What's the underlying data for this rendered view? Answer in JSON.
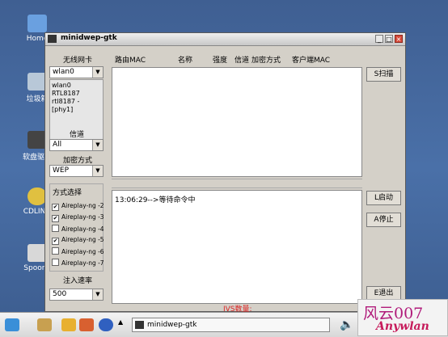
{
  "desktop": {
    "icons": [
      "Home",
      "垃圾箱",
      "软盘驱动",
      "CDLING",
      "Spoonv"
    ]
  },
  "window": {
    "title": "minidwep-gtk",
    "buttons": {
      "minimize": "_",
      "maximize": "□",
      "close": "×"
    }
  },
  "left": {
    "wireless_card_label": "无线网卡",
    "wireless_card_value": "wlan0",
    "interface_info": [
      "wlan0 RTL8187",
      "rtl8187 - [phy1]"
    ],
    "channel_label": "信道",
    "channel_value": "All",
    "encryption_label": "加密方式",
    "encryption_value": "WEP",
    "methods_label": "方式选择",
    "methods": [
      {
        "label": "Aireplay-ng -2",
        "checked": true
      },
      {
        "label": "Aireplay-ng -3",
        "checked": true
      },
      {
        "label": "Aireplay-ng -4",
        "checked": false
      },
      {
        "label": "Aireplay-ng -5",
        "checked": true
      },
      {
        "label": "Aireplay-ng -6",
        "checked": false
      },
      {
        "label": "Aireplay-ng -7",
        "checked": false
      }
    ],
    "inject_rate_label": "注入速率",
    "inject_rate_value": "500"
  },
  "table": {
    "headers": [
      "路由MAC",
      "名称",
      "强度",
      "信道",
      "加密方式",
      "客户端MAC"
    ]
  },
  "log": {
    "lines": [
      "13:06:29-->等待命令中"
    ]
  },
  "actions": {
    "scan": "S扫描",
    "start": "L启动",
    "stop": "A停止",
    "exit": "E退出"
  },
  "status": {
    "ivs": "IVS数量:"
  },
  "taskbar": {
    "task_label": "minidwep-gtk"
  },
  "watermark": {
    "line1": "风云007",
    "line2": "Anywlan"
  }
}
